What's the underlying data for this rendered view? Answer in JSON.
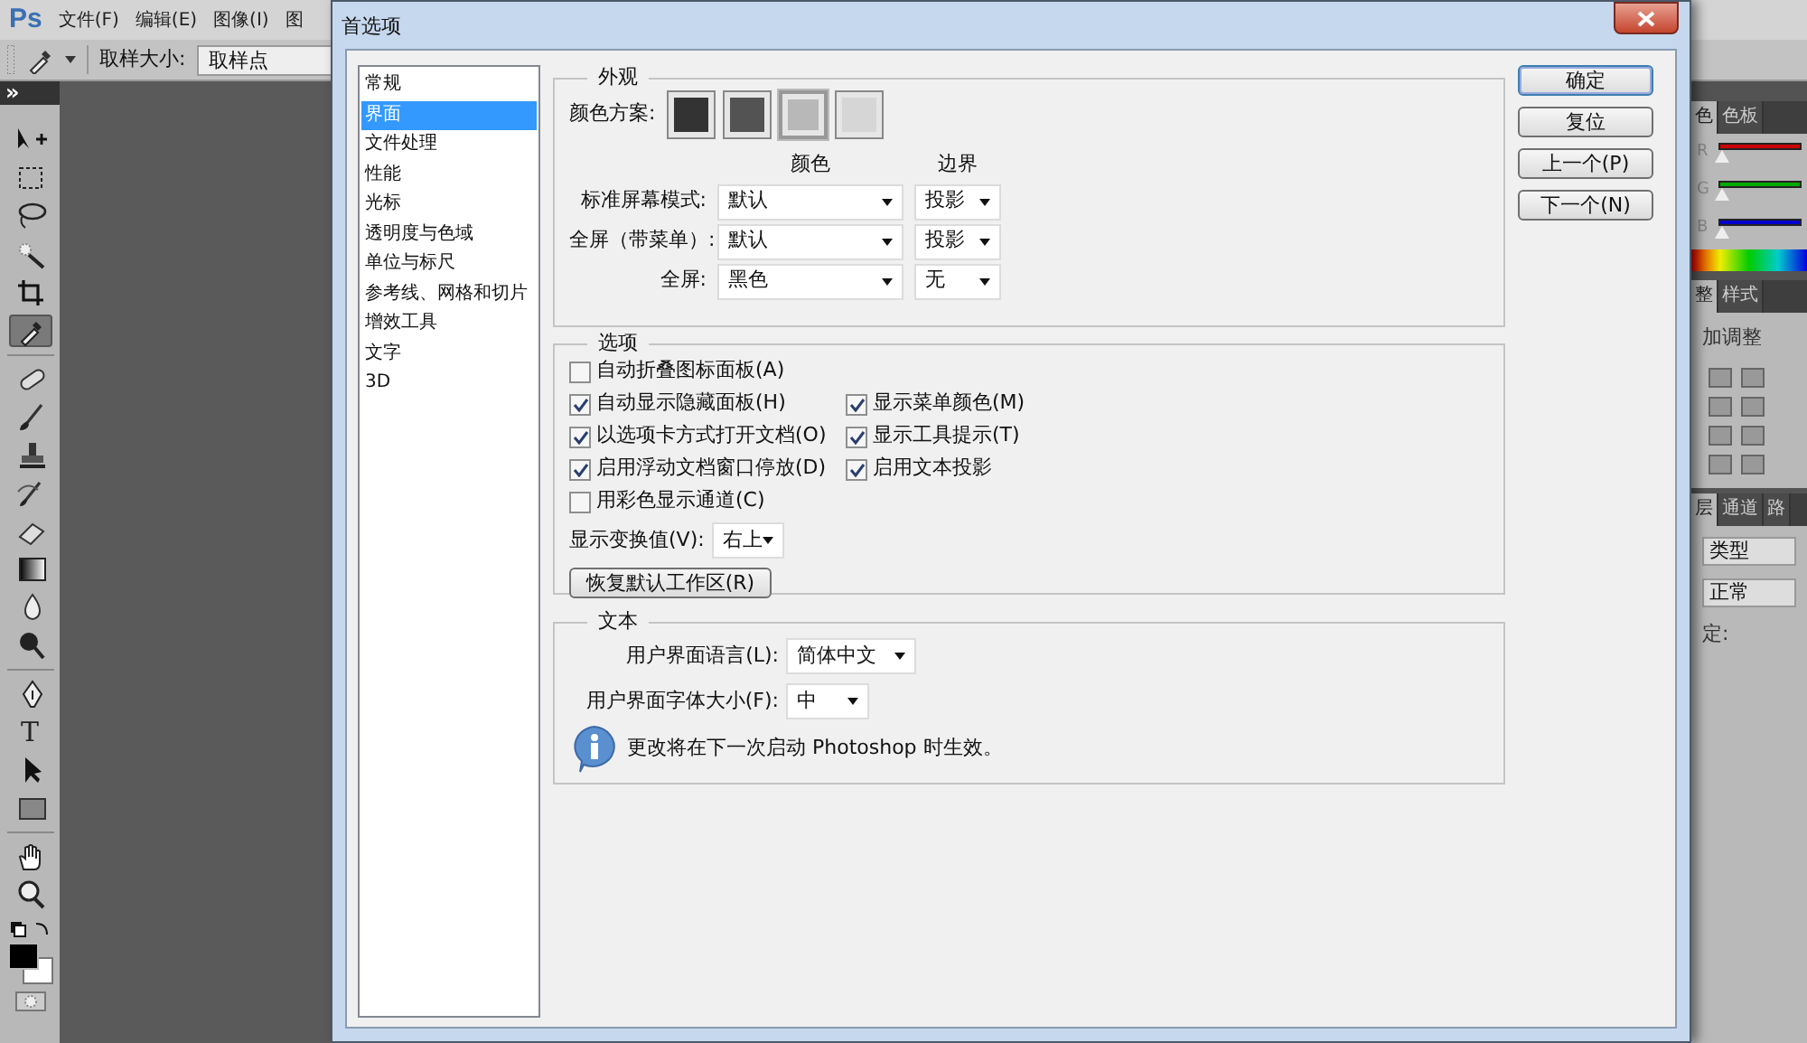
{
  "app": {
    "logo": "Ps",
    "menu": [
      "文件(F)",
      "编辑(E)",
      "图像(I)",
      "图"
    ],
    "options_bar": {
      "sample_label": "取样大小:",
      "sample_value": "取样点",
      "collapse_glyph": "»"
    },
    "tools": [
      {
        "kind": "move",
        "selected": false
      },
      {
        "kind": "marquee",
        "selected": false
      },
      {
        "kind": "lasso",
        "selected": false
      },
      {
        "kind": "wand",
        "selected": false
      },
      {
        "kind": "crop",
        "selected": false
      },
      {
        "kind": "eyedropper",
        "selected": true
      },
      {
        "kind": "healing",
        "selected": false
      },
      {
        "kind": "brush",
        "selected": false
      },
      {
        "kind": "stamp",
        "selected": false
      },
      {
        "kind": "history",
        "selected": false
      },
      {
        "kind": "eraser",
        "selected": false
      },
      {
        "kind": "gradient",
        "selected": false
      },
      {
        "kind": "blur",
        "selected": false
      },
      {
        "kind": "dodge",
        "selected": false
      },
      {
        "kind": "pen",
        "selected": false
      },
      {
        "kind": "type",
        "selected": false,
        "glyph": "T"
      },
      {
        "kind": "path",
        "selected": false
      },
      {
        "kind": "shape",
        "selected": false
      },
      {
        "kind": "hand",
        "selected": false
      },
      {
        "kind": "zoom",
        "selected": false
      }
    ],
    "right_panel": {
      "color_tabs": [
        {
          "label": "色",
          "selected": true
        },
        {
          "label": "色板",
          "selected": false
        }
      ],
      "channels": [
        {
          "label": "R",
          "color": "#cc0000",
          "level": 0
        },
        {
          "label": "G",
          "color": "#00aa00",
          "level": 0
        },
        {
          "label": "B",
          "color": "#0000cc",
          "level": 0
        }
      ],
      "adjust_tabs": [
        {
          "label": "整",
          "selected": true
        },
        {
          "label": "样式",
          "selected": false
        }
      ],
      "adjust_title": "加调整",
      "layer_tabs": [
        {
          "label": "层",
          "selected": true
        },
        {
          "label": "通道",
          "selected": false
        },
        {
          "label": "路",
          "selected": false
        }
      ],
      "kind_filter": "类型",
      "blend_mode": "正常",
      "lock_label": "定:"
    }
  },
  "dialog": {
    "title": "首选项",
    "categories": [
      {
        "label": "常规",
        "selected": false
      },
      {
        "label": "界面",
        "selected": true
      },
      {
        "label": "文件处理",
        "selected": false
      },
      {
        "label": "性能",
        "selected": false
      },
      {
        "label": "光标",
        "selected": false
      },
      {
        "label": "透明度与色域",
        "selected": false
      },
      {
        "label": "单位与标尺",
        "selected": false
      },
      {
        "label": "参考线、网格和切片",
        "selected": false
      },
      {
        "label": "增效工具",
        "selected": false
      },
      {
        "label": "文字",
        "selected": false
      },
      {
        "label": "3D",
        "selected": false
      }
    ],
    "appearance": {
      "title": "外观",
      "scheme_label": "颜色方案:",
      "swatches": [
        {
          "color": "#333333",
          "selected": false
        },
        {
          "color": "#535353",
          "selected": false
        },
        {
          "color": "#b8b8b8",
          "selected": true
        },
        {
          "color": "#d6d6d6",
          "selected": false
        }
      ],
      "color_header": "颜色",
      "border_header": "边界",
      "rows": [
        {
          "label": "标准屏幕模式:",
          "color_mode": "默认",
          "border_mode": "投影"
        },
        {
          "label": "全屏（带菜单）:",
          "color_mode": "默认",
          "border_mode": "投影"
        },
        {
          "label": "全屏:",
          "color_mode": "黑色",
          "border_mode": "无"
        }
      ]
    },
    "options": {
      "title": "选项",
      "left": [
        {
          "label": "自动折叠图标面板(A)",
          "checked": false
        },
        {
          "label": "自动显示隐藏面板(H)",
          "checked": true
        },
        {
          "label": "以选项卡方式打开文档(O)",
          "checked": true
        },
        {
          "label": "启用浮动文档窗口停放(D)",
          "checked": true
        },
        {
          "label": "用彩色显示通道(C)",
          "checked": false
        }
      ],
      "right": [
        {
          "label": "显示菜单颜色(M)",
          "checked": true
        },
        {
          "label": "显示工具提示(T)",
          "checked": true
        },
        {
          "label": "启用文本投影",
          "checked": true
        }
      ],
      "transform_label": "显示变换值(V):",
      "transform_value": "右上",
      "reset_button": "恢复默认工作区(R)"
    },
    "text": {
      "title": "文本",
      "language_label": "用户界面语言(L):",
      "language_value": "简体中文",
      "size_label": "用户界面字体大小(F):",
      "size_value": "中",
      "note": "更改将在下一次启动 Photoshop 时生效。"
    },
    "buttons": [
      {
        "label": "确定",
        "default": true
      },
      {
        "label": "复位",
        "default": false
      },
      {
        "label": "上一个(P)",
        "default": false
      },
      {
        "label": "下一个(N)",
        "default": false
      }
    ]
  }
}
